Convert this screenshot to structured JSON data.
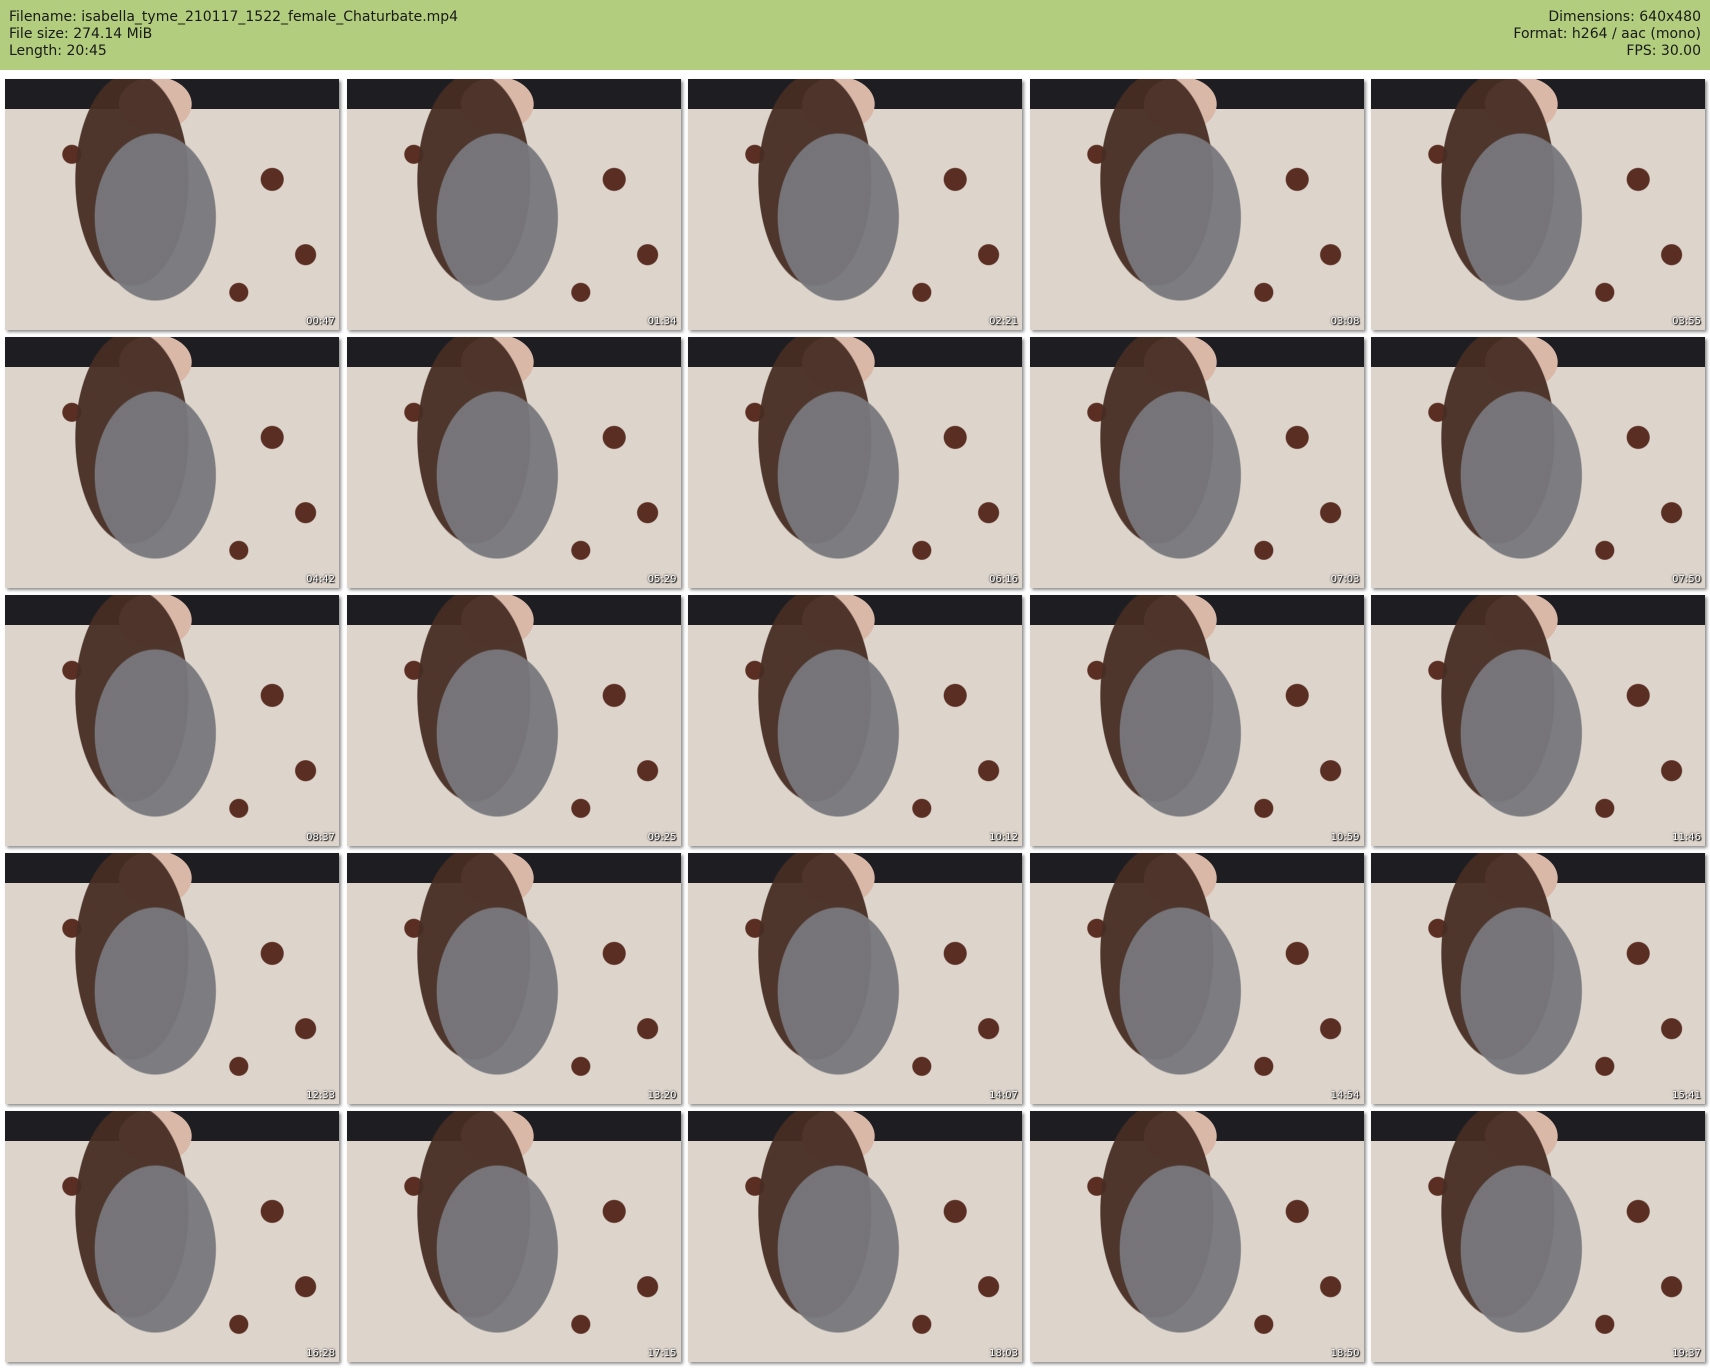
{
  "header": {
    "filename": "Filename: isabella_tyme_210117_1522_female_Chaturbate.mp4",
    "file_size": "File size: 274.14 MiB",
    "length": "Length: 20:45",
    "dimensions": "Dimensions: 640x480",
    "format": "Format: h264 / aac (mono)",
    "fps": "FPS: 30.00"
  },
  "thumbnails": [
    {
      "time": "00:47"
    },
    {
      "time": "01:34"
    },
    {
      "time": "02:21"
    },
    {
      "time": "03:08"
    },
    {
      "time": "03:55"
    },
    {
      "time": "04:42"
    },
    {
      "time": "05:29"
    },
    {
      "time": "06:16"
    },
    {
      "time": "07:03"
    },
    {
      "time": "07:50"
    },
    {
      "time": "08:37"
    },
    {
      "time": "09:25"
    },
    {
      "time": "10:12"
    },
    {
      "time": "10:59"
    },
    {
      "time": "11:46"
    },
    {
      "time": "12:33"
    },
    {
      "time": "13:20"
    },
    {
      "time": "14:07"
    },
    {
      "time": "14:54"
    },
    {
      "time": "15:41"
    },
    {
      "time": "16:28"
    },
    {
      "time": "17:15"
    },
    {
      "time": "18:03"
    },
    {
      "time": "18:50"
    },
    {
      "time": "19:37"
    }
  ]
}
